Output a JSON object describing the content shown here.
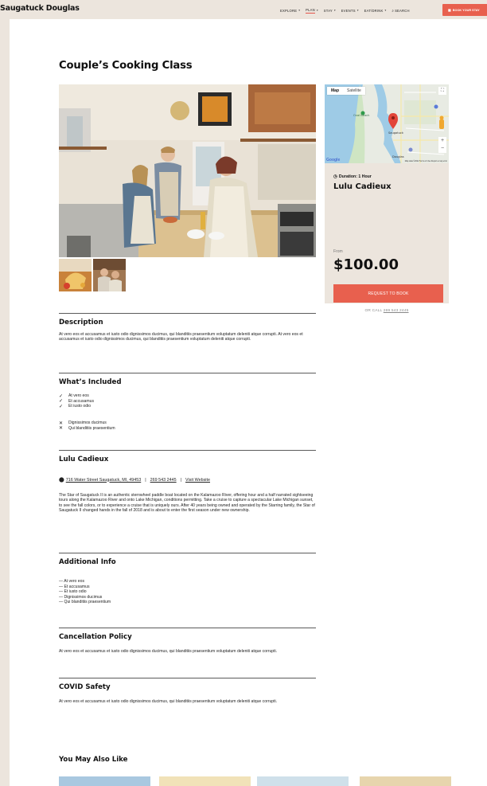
{
  "header": {
    "logo": "Saugatuck Douglas",
    "nav": [
      {
        "label": "EXPLORE",
        "has_menu": true
      },
      {
        "label": "PLAN",
        "has_menu": true,
        "active": true
      },
      {
        "label": "STAY",
        "has_menu": true
      },
      {
        "label": "EVENTS",
        "has_menu": true
      },
      {
        "label": "EAT/DRINK",
        "has_menu": true
      },
      {
        "label": "SEARCH",
        "has_menu": false
      }
    ],
    "book_button": "BOOK YOUR STAY"
  },
  "page": {
    "title": "Couple’s Cooking Class"
  },
  "booking": {
    "map": {
      "tab_map": "Map",
      "tab_satellite": "Satellite",
      "google": "Google",
      "attribution": "Map data ©2022   Terms of Use   Report a map error",
      "places": [
        "Oval Beach",
        "Saugatuck",
        "Douglas"
      ]
    },
    "duration": "Duration: 1 Hour",
    "host": "Lulu Cadieux",
    "from_label": "From",
    "price": "$100.00",
    "request_button": "REQUEST TO BOOK",
    "or_call_prefix": "OR CALL",
    "phone": "269 543 2445"
  },
  "description": {
    "heading": "Description",
    "text": "At vero eos et accusamus et iusto odio dignissimos ducimus, qui blanditiis praesentium voluptatum deleniti atque corrupti. At vero eos et accusamus et iusto odio dignissimos ducimus, qui blanditiis praesentium voluptatum deleniti atque corrupti."
  },
  "included": {
    "heading": "What’s Included",
    "yes": [
      "At vero eos",
      "Et accusamus",
      "Et iusto odio"
    ],
    "no": [
      "Dignissimos ducimus",
      "Qui blanditiis praesentium"
    ]
  },
  "host_section": {
    "heading": "Lulu Cadieux",
    "address": "716 Water Street Saugatuck, MI, 49453",
    "phone": "269 543 2445",
    "website": "Visit Website",
    "bio": "The Star of Saugatuck II is an authentic sternwheel paddle boat located on the Kalamazoo River, offering hour and a half narrated sightseeing tours along the Kalamazoo River and onto Lake Michigan, conditions permitting.  Take a cruise to capture a spectacular Lake Michigan sunset, to see the fall colors, or to experience a cruise that is uniquely ours.  After 40 years being owned and operated by the Starring family, the Star of Saugatuck II changed hands in the fall of 2018 and is about to enter the first season under new ownership."
  },
  "additional": {
    "heading": "Additional Info",
    "items": [
      "— At vero eos",
      "— Et accusamus",
      "— Et iusto odio",
      "— Dignissimos ducimus",
      "— Qui blanditiis praesentium"
    ]
  },
  "cancellation": {
    "heading": "Cancellation Policy",
    "text": "At vero eos et accusamus et iusto odio dignissimos ducimus, qui blanditiis praesentium voluptatum deleniti atque corrupti."
  },
  "covid": {
    "heading": "COVID Safety",
    "text": "At vero eos et accusamus et iusto odio dignissimos ducimus, qui blanditiis praesentium voluptatum deleniti atque corrupti."
  },
  "also": {
    "heading": "You May Also Like"
  },
  "colors": {
    "accent": "#e8604e",
    "sand": "#ece5dd"
  }
}
